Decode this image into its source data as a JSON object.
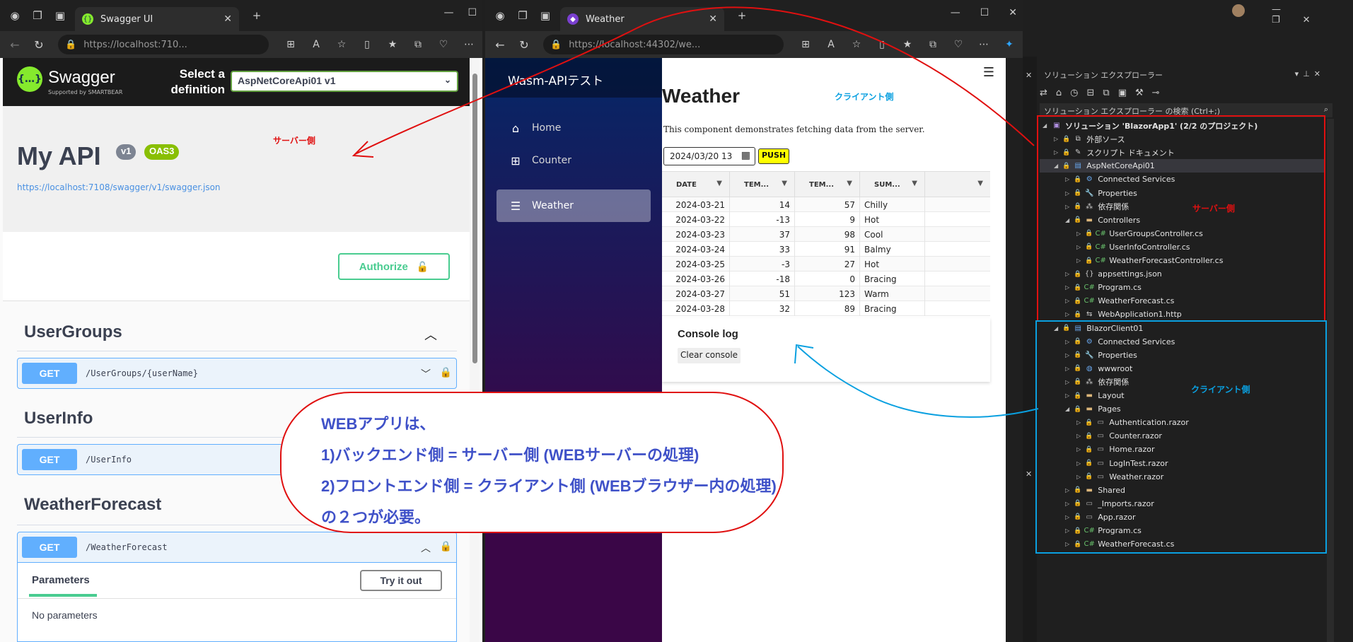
{
  "swagger_window": {
    "tab_title": "Swagger UI",
    "url": "https://localhost:710...",
    "logo_name": "Swagger",
    "logo_sub": "Supported by SMARTBEAR",
    "select_label_1": "Select a",
    "select_label_2": "definition",
    "definition": "AspNetCoreApi01 v1",
    "api_title": "My API",
    "version_badge": "v1",
    "oas_badge": "OAS3",
    "spec_link": "https://localhost:7108/swagger/v1/swagger.json",
    "authorize_label": "Authorize",
    "sections": [
      {
        "title": "UserGroups",
        "method": "GET",
        "path": "/UserGroups/{userName}"
      },
      {
        "title": "UserInfo",
        "method": "GET",
        "path": "/UserInfo"
      },
      {
        "title": "WeatherForecast",
        "method": "GET",
        "path": "/WeatherForecast"
      }
    ],
    "params_tab": "Parameters",
    "try_label": "Try it out",
    "no_params": "No parameters"
  },
  "blazor_window": {
    "tab_title": "Weather",
    "url": "https://localhost:44302/we...",
    "brand": "Wasm-APIテスト",
    "nav": [
      {
        "label": "Home",
        "icon": "home-icon"
      },
      {
        "label": "Counter",
        "icon": "plus-square-icon"
      },
      {
        "label": "Weather",
        "icon": "list-icon"
      }
    ],
    "page_title": "Weather",
    "description": "This component demonstrates fetching data from the server.",
    "date_value": "2024/03/20 13",
    "push_label": "PUSH",
    "columns": [
      "DATE",
      "TEM...",
      "TEM...",
      "SUM...",
      ""
    ],
    "rows": [
      {
        "date": "2024-03-21",
        "c": "14",
        "f": "57",
        "summary": "Chilly"
      },
      {
        "date": "2024-03-22",
        "c": "-13",
        "f": "9",
        "summary": "Hot"
      },
      {
        "date": "2024-03-23",
        "c": "37",
        "f": "98",
        "summary": "Cool"
      },
      {
        "date": "2024-03-24",
        "c": "33",
        "f": "91",
        "summary": "Balmy"
      },
      {
        "date": "2024-03-25",
        "c": "-3",
        "f": "27",
        "summary": "Hot"
      },
      {
        "date": "2024-03-26",
        "c": "-18",
        "f": "0",
        "summary": "Bracing"
      },
      {
        "date": "2024-03-27",
        "c": "51",
        "f": "123",
        "summary": "Warm"
      },
      {
        "date": "2024-03-28",
        "c": "32",
        "f": "89",
        "summary": "Bracing"
      }
    ],
    "console_title": "Console log",
    "clear_label": "Clear console"
  },
  "solution_explorer": {
    "title": "ソリューション エクスプローラー",
    "search_placeholder": "ソリューション エクスプローラー の検索 (Ctrl+;)",
    "items": [
      {
        "label": "ソリューション 'BlazorApp1' (2/2 のプロジェクト)",
        "depth": 0,
        "icon": "solution-icon"
      },
      {
        "label": "外部ソース",
        "depth": 1,
        "icon": "external-icon"
      },
      {
        "label": "スクリプト ドキュメント",
        "depth": 1,
        "icon": "script-icon"
      },
      {
        "label": "AspNetCoreApi01",
        "depth": 1,
        "icon": "project-icon"
      },
      {
        "label": "Connected Services",
        "depth": 2,
        "icon": "connected-icon"
      },
      {
        "label": "Properties",
        "depth": 2,
        "icon": "properties-icon"
      },
      {
        "label": "依存関係",
        "depth": 2,
        "icon": "dependencies-icon"
      },
      {
        "label": "Controllers",
        "depth": 2,
        "icon": "folder-icon"
      },
      {
        "label": "UserGroupsController.cs",
        "depth": 3,
        "icon": "csharp-icon"
      },
      {
        "label": "UserInfoController.cs",
        "depth": 3,
        "icon": "csharp-icon"
      },
      {
        "label": "WeatherForecastController.cs",
        "depth": 3,
        "icon": "csharp-icon"
      },
      {
        "label": "appsettings.json",
        "depth": 2,
        "icon": "json-icon"
      },
      {
        "label": "Program.cs",
        "depth": 2,
        "icon": "csharp-icon"
      },
      {
        "label": "WeatherForecast.cs",
        "depth": 2,
        "icon": "csharp-icon"
      },
      {
        "label": "WebApplication1.http",
        "depth": 2,
        "icon": "http-icon"
      },
      {
        "label": "BlazorClient01",
        "depth": 1,
        "icon": "project-icon"
      },
      {
        "label": "Connected Services",
        "depth": 2,
        "icon": "connected-icon"
      },
      {
        "label": "Properties",
        "depth": 2,
        "icon": "properties-icon"
      },
      {
        "label": "wwwroot",
        "depth": 2,
        "icon": "globe-icon"
      },
      {
        "label": "依存関係",
        "depth": 2,
        "icon": "dependencies-icon"
      },
      {
        "label": "Layout",
        "depth": 2,
        "icon": "folder-icon"
      },
      {
        "label": "Pages",
        "depth": 2,
        "icon": "folder-icon"
      },
      {
        "label": "Authentication.razor",
        "depth": 3,
        "icon": "razor-icon"
      },
      {
        "label": "Counter.razor",
        "depth": 3,
        "icon": "razor-icon"
      },
      {
        "label": "Home.razor",
        "depth": 3,
        "icon": "razor-icon"
      },
      {
        "label": "LogInTest.razor",
        "depth": 3,
        "icon": "razor-icon"
      },
      {
        "label": "Weather.razor",
        "depth": 3,
        "icon": "razor-icon"
      },
      {
        "label": "Shared",
        "depth": 2,
        "icon": "folder-icon"
      },
      {
        "label": "_Imports.razor",
        "depth": 2,
        "icon": "razor-icon"
      },
      {
        "label": "App.razor",
        "depth": 2,
        "icon": "razor-icon"
      },
      {
        "label": "Program.cs",
        "depth": 2,
        "icon": "csharp-icon"
      },
      {
        "label": "WeatherForecast.cs",
        "depth": 2,
        "icon": "csharp-icon"
      }
    ]
  },
  "annotations": {
    "server_label": "サーバー側",
    "client_label": "クライアント側",
    "bubble_lines": [
      "WEBアプリは、",
      "1)バックエンド側 = サーバー側 (WEBサーバーの処理)",
      "2)フロントエンド側 = クライアント側 (WEBブラウザー内の処理)",
      "の２つが必要。"
    ]
  },
  "colors": {
    "red": "#e01010",
    "blue": "#0aa0e0",
    "get_blue": "#61affe",
    "swagger_green": "#85ea2d"
  }
}
